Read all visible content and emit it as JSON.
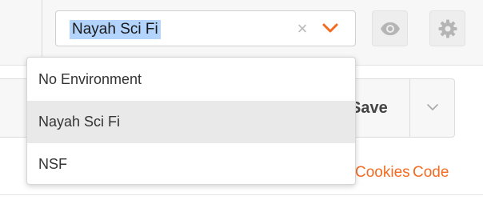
{
  "environment": {
    "selected": "Nayah Sci Fi",
    "clear_symbol": "×",
    "clear_icon": "close-icon",
    "caret_icon": "chevron-down-icon",
    "accent_color": "#f26b21",
    "selection_highlight_color": "#b3d4fc",
    "options": [
      "No Environment",
      "Nayah Sci Fi",
      "NSF"
    ],
    "highlighted_option": "Nayah Sci Fi"
  },
  "toolbar": {
    "quick_look_icon": "eye-icon",
    "settings_icon": "gear-icon"
  },
  "request": {
    "save_label": "Save",
    "save_menu_icon": "chevron-down-icon"
  },
  "links": {
    "cookies": "Cookies",
    "code": "Code"
  }
}
